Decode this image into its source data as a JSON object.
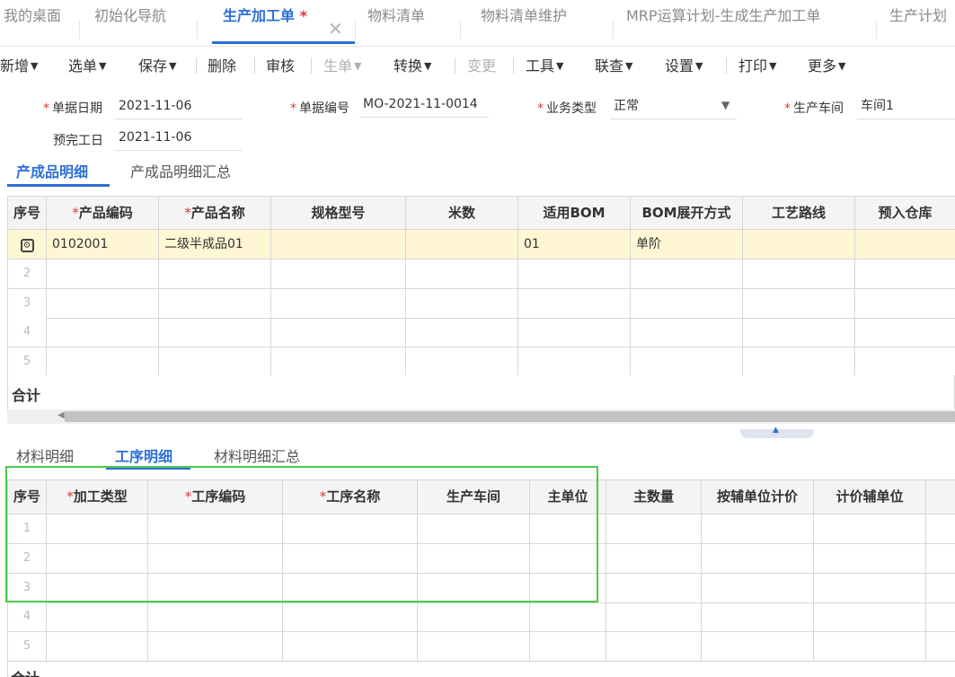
{
  "tabs": [
    {
      "label": "我的桌面"
    },
    {
      "label": "初始化导航"
    },
    {
      "label": "生产加工单",
      "modified_mark": "*"
    },
    {
      "label": "物料清单"
    },
    {
      "label": "物料清单维护"
    },
    {
      "label": "MRP运算计划-生成生产加工单"
    },
    {
      "label": "生产计划"
    }
  ],
  "toolbar": {
    "new": "新增",
    "select": "选单",
    "save": "保存",
    "delete": "删除",
    "audit": "审核",
    "generate": "生单",
    "convert": "转换",
    "change": "变更",
    "tools": "工具",
    "query": "联查",
    "settings": "设置",
    "print": "打印",
    "more": "更多"
  },
  "form": {
    "date_label": "单据日期",
    "date_value": "2021-11-06",
    "number_label": "单据编号",
    "number_value": "MO-2021-11-0014",
    "biz_type_label": "业务类型",
    "biz_type_value": "正常",
    "workshop_label": "生产车间",
    "workshop_value": "车间1",
    "finish_label": "预完工日",
    "finish_value": "2021-11-06"
  },
  "product_tabs": [
    "产成品明细",
    "产成品明细汇总"
  ],
  "product_grid": {
    "headers": [
      "序号",
      "产品编码",
      "产品名称",
      "规格型号",
      "米数",
      "适用BOM",
      "BOM展开方式",
      "工艺路线",
      "预入仓库"
    ],
    "rows": [
      {
        "num": "",
        "code": "0102001",
        "name": "二级半成品01",
        "spec": "",
        "meters": "",
        "bom": "01",
        "expand": "单阶",
        "route": "",
        "warehouse": ""
      },
      {
        "num": "2"
      },
      {
        "num": "3"
      },
      {
        "num": "4"
      },
      {
        "num": "5"
      }
    ],
    "total_label": "合计"
  },
  "detail_tabs": [
    "材料明细",
    "工序明细",
    "材料明细汇总"
  ],
  "process_grid": {
    "headers": [
      "序号",
      "加工类型",
      "工序编码",
      "工序名称",
      "生产车间",
      "主单位",
      "主数量",
      "按辅单位计价",
      "计价辅单位"
    ],
    "rows": [
      "1",
      "2",
      "3",
      "4",
      "5"
    ],
    "total_label": "合计"
  }
}
